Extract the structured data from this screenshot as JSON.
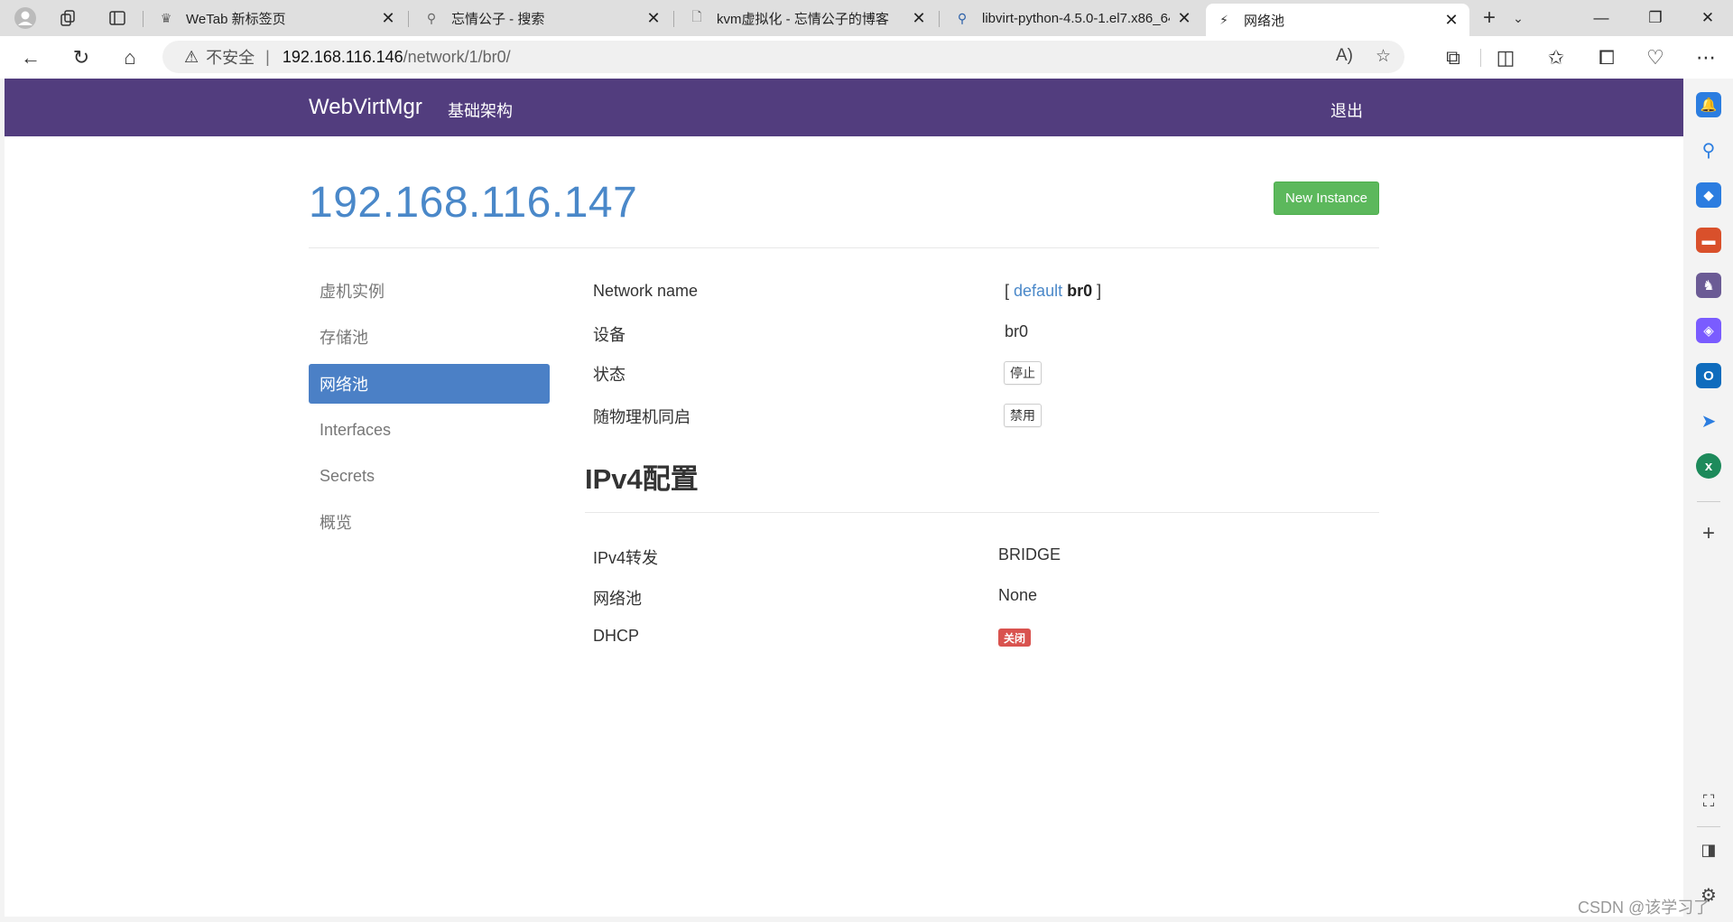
{
  "browser": {
    "tabs": [
      {
        "title": "WeTab 新标签页",
        "active": false
      },
      {
        "title": "忘情公子 - 搜索",
        "active": false
      },
      {
        "title": "kvm虚拟化 - 忘情公子的博客",
        "active": false
      },
      {
        "title": "libvirt-python-4.5.0-1.el7.x86_64",
        "active": false
      },
      {
        "title": "网络池",
        "active": true
      }
    ],
    "address": {
      "security_label": "不安全",
      "host": "192.168.116.146",
      "path": "/network/1/br0/"
    }
  },
  "navbar": {
    "brand": "WebVirtMgr",
    "infra_link": "基础架构",
    "logout_link": "退出"
  },
  "page": {
    "host_title": "192.168.116.147",
    "new_instance_label": "New Instance"
  },
  "menu": {
    "items": [
      {
        "label": "虚机实例"
      },
      {
        "label": "存储池"
      },
      {
        "label": "网络池"
      },
      {
        "label": "Interfaces"
      },
      {
        "label": "Secrets"
      },
      {
        "label": "概览"
      }
    ]
  },
  "network": {
    "name_label": "Network name",
    "name_bracket_open": "[",
    "name_default_link": "default",
    "name_current": "br0",
    "name_bracket_close": "]",
    "device_label": "设备",
    "device_value": "br0",
    "state_label": "状态",
    "state_button": "停止",
    "autostart_label": "随物理机同启",
    "autostart_button": "禁用"
  },
  "ipv4": {
    "heading": "IPv4配置",
    "forward_label": "IPv4转发",
    "forward_value": "BRIDGE",
    "pool_label": "网络池",
    "pool_value": "None",
    "dhcp_label": "DHCP",
    "dhcp_value": "关闭"
  },
  "colors": {
    "navbar": "#523d7e",
    "accent_blue": "#4a88c9",
    "active_menu": "#4b80c6",
    "success": "#5cb85c",
    "danger": "#d9534f"
  },
  "watermark": "CSDN @该学习了"
}
